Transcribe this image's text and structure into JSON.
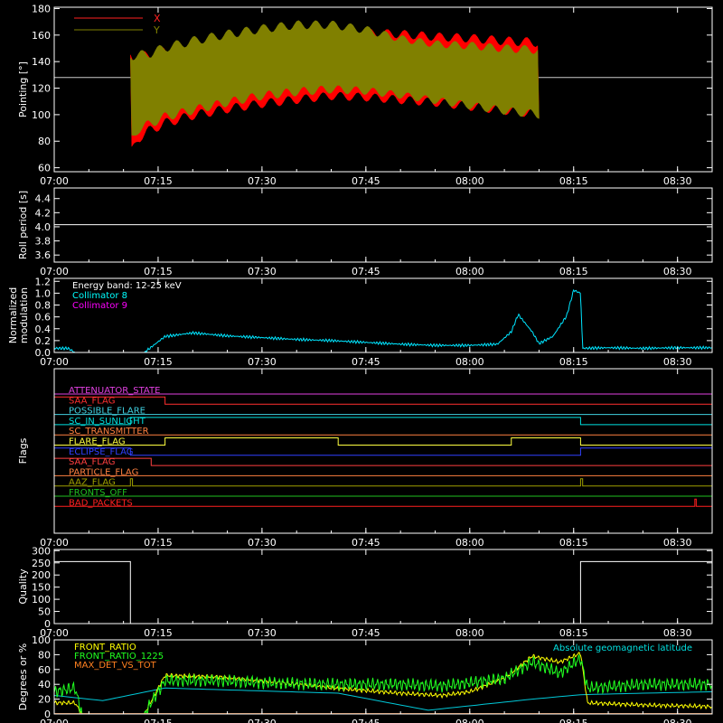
{
  "chart_data": [
    {
      "type": "line",
      "ylabel": "Pointing [°]",
      "ylim": [
        57,
        181
      ],
      "yticks": [
        60,
        80,
        100,
        120,
        140,
        160,
        180
      ],
      "xticks": [
        "07:00",
        "07:15",
        "07:30",
        "07:45",
        "08:00",
        "08:15",
        "08:30"
      ],
      "xlim_minutes": [
        420,
        515
      ],
      "baseline": 128,
      "legend": [
        {
          "name": "X",
          "color": "#ff2020"
        },
        {
          "name": "Y",
          "color": "#808000"
        }
      ],
      "series": [
        {
          "name": "X",
          "color": "#ff0000",
          "x": [
            431,
            432,
            434,
            436,
            440,
            445,
            450,
            455,
            460,
            465,
            470,
            475,
            480,
            485,
            490
          ],
          "upper": [
            150,
            147,
            149,
            152,
            156,
            160,
            163,
            165,
            166,
            165,
            164,
            162,
            161,
            159,
            158
          ],
          "lower": [
            63,
            78,
            85,
            90,
            96,
            101,
            105,
            108,
            111,
            110,
            108,
            106,
            103,
            100,
            97
          ]
        },
        {
          "name": "Y",
          "color": "#808000",
          "x": [
            431,
            432,
            434,
            436,
            440,
            445,
            450,
            455,
            460,
            465,
            470,
            475,
            480,
            485,
            490
          ],
          "upper": [
            150,
            148,
            150,
            154,
            159,
            164,
            168,
            171,
            171,
            167,
            160,
            156,
            155,
            153,
            152
          ],
          "lower": [
            75,
            85,
            90,
            95,
            100,
            106,
            111,
            114,
            116,
            115,
            112,
            108,
            104,
            100,
            97
          ]
        }
      ]
    },
    {
      "type": "line",
      "ylabel": "Roll period [s]",
      "ylim": [
        3.5,
        4.55
      ],
      "yticks": [
        3.6,
        3.8,
        4.0,
        4.2,
        4.4
      ],
      "xticks": [
        "07:00",
        "07:15",
        "07:30",
        "07:45",
        "08:00",
        "08:15",
        "08:30"
      ],
      "xlim_minutes": [
        420,
        515
      ],
      "series": [
        {
          "name": "",
          "color": "#ffffff",
          "x": [
            420,
            515
          ],
          "y": [
            4.03,
            4.03
          ]
        }
      ]
    },
    {
      "type": "line",
      "ylabel": "Normalized modulation",
      "ylim": [
        0,
        1.25
      ],
      "yticks": [
        0.0,
        0.2,
        0.4,
        0.6,
        0.8,
        1.0,
        1.2
      ],
      "xticks": [
        "07:00",
        "07:15",
        "07:30",
        "07:45",
        "08:00",
        "08:15",
        "08:30"
      ],
      "xlim_minutes": [
        420,
        515
      ],
      "legend": [
        {
          "name": "Energy band: 12-25 keV",
          "color": "#ffffff"
        },
        {
          "name": "Collimator 8",
          "color": "#00ffff"
        },
        {
          "name": "Collimator 9",
          "color": "#ff00ff"
        }
      ],
      "series": [
        {
          "name": "Collimator 8",
          "color": "#00e5ff",
          "x": [
            420,
            422,
            423,
            433,
            436,
            440,
            445,
            450,
            455,
            460,
            465,
            470,
            475,
            480,
            484,
            486,
            487,
            489,
            490,
            492,
            494,
            495,
            496,
            496.3,
            500,
            505,
            510,
            515
          ],
          "y": [
            0.07,
            0.07,
            0.0,
            0.0,
            0.27,
            0.33,
            0.28,
            0.25,
            0.22,
            0.2,
            0.17,
            0.14,
            0.12,
            0.12,
            0.14,
            0.35,
            0.64,
            0.35,
            0.15,
            0.27,
            0.62,
            1.05,
            1.0,
            0.07,
            0.08,
            0.07,
            0.08,
            0.08
          ]
        },
        {
          "name": "Collimator 9",
          "color": "#ff00ff",
          "x": [
            420,
            515
          ],
          "y": [
            0.0,
            0.0
          ]
        }
      ]
    },
    {
      "type": "line",
      "ylabel": "Flags",
      "xticks": [
        "07:00",
        "07:15",
        "07:30",
        "07:45",
        "08:00",
        "08:15",
        "08:30"
      ],
      "xlim_minutes": [
        420,
        515
      ],
      "flags": [
        {
          "name": "ATTENUATOR_STATE",
          "color": "#e040e0",
          "high": []
        },
        {
          "name": "SAA_FLAG",
          "color": "#ff3030",
          "high": [
            [
              420,
              436
            ]
          ]
        },
        {
          "name": "POSSIBLE_FLARE",
          "color": "#40d0e0",
          "high": []
        },
        {
          "name": "SC_IN_SUNLIGHT",
          "color": "#00e0e0",
          "high": [
            [
              431,
              496
            ]
          ]
        },
        {
          "name": "SC_TRANSMITTER",
          "color": "#ff8040",
          "high": []
        },
        {
          "name": "FLARE_FLAG",
          "color": "#ffff40",
          "high": [
            [
              436,
              461
            ],
            [
              486,
              496
            ]
          ]
        },
        {
          "name": "ECLIPSE_FLAG",
          "color": "#3040ff",
          "high": [
            [
              420,
              431
            ],
            [
              496,
              515
            ]
          ]
        },
        {
          "name": "SAA_FLAG",
          "color": "#ff4040",
          "high": [
            [
              420,
              434
            ]
          ]
        },
        {
          "name": "PARTICLE_FLAG",
          "color": "#ff8040",
          "high": []
        },
        {
          "name": "AAZ_FLAG",
          "color": "#a0a000",
          "high": [
            [
              431,
              431.3
            ],
            [
              496,
              496.3
            ]
          ]
        },
        {
          "name": "FRONTS_OFF",
          "color": "#20c020",
          "high": []
        },
        {
          "name": "BAD_PACKETS",
          "color": "#ff2020",
          "high": [
            [
              512.5,
              512.7
            ]
          ]
        }
      ]
    },
    {
      "type": "line",
      "ylabel": "Quality",
      "ylim": [
        0,
        305
      ],
      "yticks": [
        0,
        50,
        100,
        150,
        200,
        250,
        300
      ],
      "xticks": [
        "07:00",
        "07:15",
        "07:30",
        "07:45",
        "08:00",
        "08:15",
        "08:30"
      ],
      "xlim_minutes": [
        420,
        515
      ],
      "series": [
        {
          "name": "",
          "color": "#ffffff",
          "x": [
            420,
            431,
            431,
            496,
            496,
            515
          ],
          "y": [
            255,
            255,
            0,
            0,
            255,
            255
          ]
        }
      ]
    },
    {
      "type": "line",
      "ylabel": "Degrees or %",
      "ylim": [
        0,
        100
      ],
      "yticks": [
        0,
        20,
        40,
        60,
        80,
        100
      ],
      "xticks": [
        "07:00",
        "07:15",
        "07:30",
        "07:45",
        "08:00",
        "08:15",
        "08:30"
      ],
      "xlim_minutes": [
        420,
        515
      ],
      "legend": [
        {
          "name": "FRONT_RATIO",
          "color": "#ffff00"
        },
        {
          "name": "FRONT_RATIO_1225",
          "color": "#20ff20"
        },
        {
          "name": "MAX_DET_VS_TOT",
          "color": "#ff8020"
        }
      ],
      "annotation": {
        "text": "Absolute geomagnetic latitude",
        "color": "#00e0e0"
      },
      "series": [
        {
          "name": "Absolute geomagnetic latitude",
          "color": "#00c8d8",
          "x": [
            420,
            427,
            436,
            461,
            474,
            489,
            496,
            505,
            515
          ],
          "y": [
            25,
            18,
            35,
            28,
            5,
            20,
            26,
            28,
            30
          ]
        },
        {
          "name": "FRONT_RATIO",
          "color": "#ffff00",
          "x": [
            420,
            423,
            424,
            433,
            436,
            444,
            450,
            460,
            470,
            476,
            480,
            485,
            489,
            493,
            496,
            497,
            505,
            515
          ],
          "y": [
            15,
            15,
            0,
            0,
            52,
            50,
            45,
            35,
            28,
            25,
            30,
            48,
            78,
            70,
            82,
            15,
            12,
            10
          ]
        },
        {
          "name": "FRONT_RATIO_1225",
          "color": "#20ff20",
          "x": [
            420,
            423,
            424,
            433,
            436,
            444,
            450,
            460,
            470,
            476,
            480,
            485,
            489,
            493,
            496,
            497,
            505,
            515
          ],
          "y": [
            30,
            35,
            0,
            0,
            45,
            45,
            42,
            40,
            40,
            38,
            42,
            48,
            70,
            55,
            75,
            35,
            40,
            40
          ]
        },
        {
          "name": "MAX_DET_VS_TOT",
          "color": "#ff8020",
          "x": [
            420,
            515
          ],
          "y": [
            0.5,
            0.5
          ]
        }
      ]
    }
  ]
}
